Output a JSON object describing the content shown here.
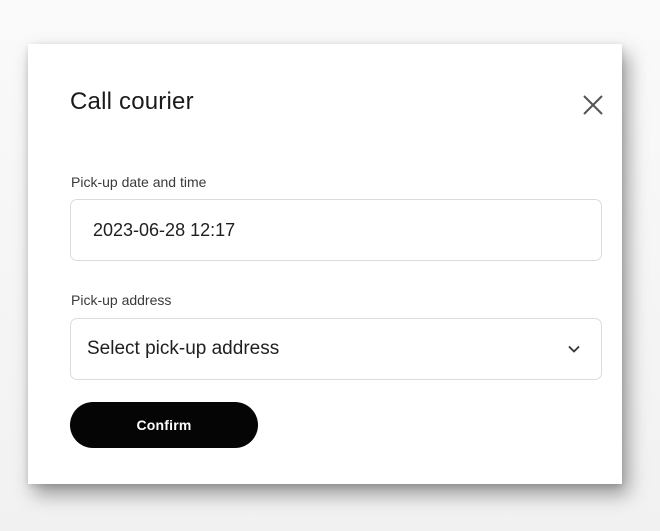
{
  "dialog": {
    "title": "Call courier",
    "close_icon": "close-icon"
  },
  "pickup_datetime": {
    "label": "Pick-up date and time",
    "value": "2023-06-28 12:17"
  },
  "pickup_address": {
    "label": "Pick-up address",
    "placeholder": "Select pick-up address",
    "icon": "chevron-down-icon"
  },
  "actions": {
    "confirm_label": "Confirm"
  },
  "colors": {
    "button_bg": "#050505",
    "button_text": "#ffffff",
    "field_border": "#dcdcdc"
  }
}
